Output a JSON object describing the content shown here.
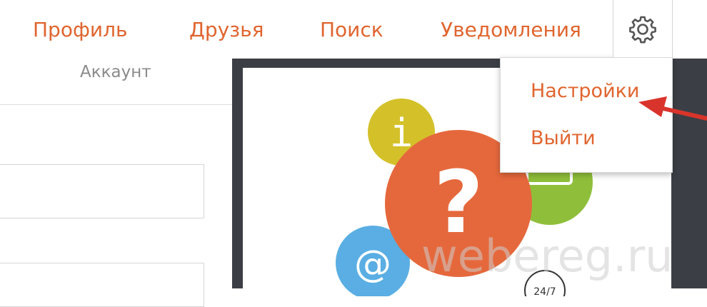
{
  "nav": {
    "items": [
      "Профиль",
      "Друзья",
      "Поиск",
      "Уведомления"
    ],
    "settings_icon": "gear-icon"
  },
  "left": {
    "account_label": "Аккаунт"
  },
  "dropdown": {
    "items": [
      "Настройки",
      "Выйти"
    ]
  },
  "illustration": {
    "info_glyph": "i",
    "question_glyph": "?",
    "at_glyph": "@",
    "support_badge": "24/7"
  },
  "watermark": "webereg.ru",
  "colors": {
    "accent": "#e0652f",
    "dark_panel": "#3b3f45",
    "bubble_yellow": "#d4c12a",
    "bubble_green": "#8fbf3a",
    "bubble_orange": "#e5683c",
    "bubble_blue": "#5aaee3",
    "arrow_red": "#d9342b"
  }
}
